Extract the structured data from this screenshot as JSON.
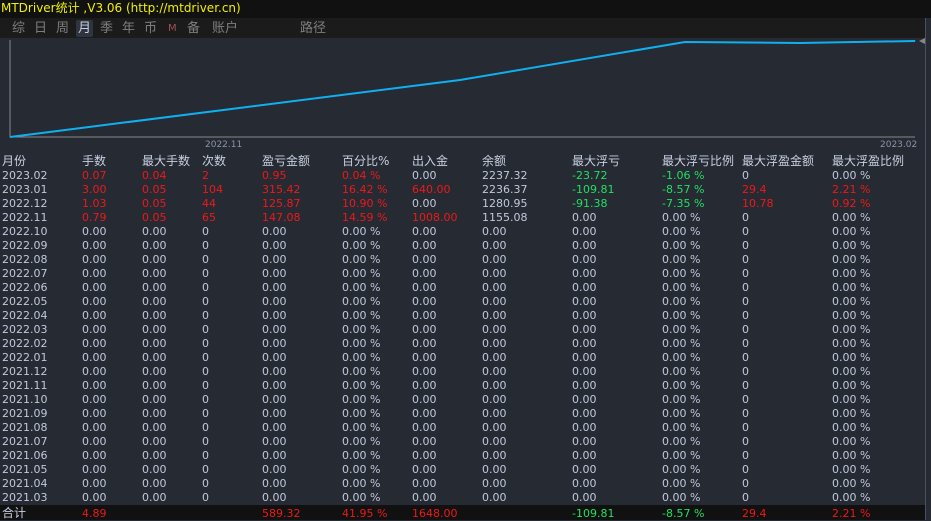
{
  "title": "MTDriver统计 ,V3.06 (http://mtdriver.cn)",
  "tabs": [
    {
      "label": "综",
      "active": false
    },
    {
      "label": "日",
      "active": false
    },
    {
      "label": "周",
      "active": false
    },
    {
      "label": "月",
      "active": true
    },
    {
      "label": "季",
      "active": false
    },
    {
      "label": "年",
      "active": false
    },
    {
      "label": "币",
      "active": false
    },
    {
      "label": "M",
      "active": false
    },
    {
      "label": "备",
      "active": false
    },
    {
      "label": "账户",
      "active": false
    },
    {
      "label": "路径",
      "active": false
    }
  ],
  "chart_data": {
    "type": "line",
    "x_labels": [
      "2022.11",
      "2023.02"
    ],
    "series": [
      {
        "name": "余额",
        "color": "#10b0f0",
        "values": [
          0,
          1155.08,
          1280.95,
          2236.37,
          2237.32
        ]
      }
    ]
  },
  "columns": [
    "月份",
    "手数",
    "最大手数",
    "次数",
    "盈亏金额",
    "百分比%",
    "出入金",
    "余额",
    "最大浮亏",
    "最大浮亏比例",
    "最大浮盈金额",
    "最大浮盈比例"
  ],
  "rows": [
    [
      "2023.02",
      "0.07",
      "0.04",
      "2",
      "0.95",
      "0.04 %",
      "0.00",
      "2237.32",
      "-23.72",
      "-1.06 %",
      "0",
      "0.00 %"
    ],
    [
      "2023.01",
      "3.00",
      "0.05",
      "104",
      "315.42",
      "16.42 %",
      "640.00",
      "2236.37",
      "-109.81",
      "-8.57 %",
      "29.4",
      "2.21 %"
    ],
    [
      "2022.12",
      "1.03",
      "0.05",
      "44",
      "125.87",
      "10.90 %",
      "0.00",
      "1280.95",
      "-91.38",
      "-7.35 %",
      "10.78",
      "0.92 %"
    ],
    [
      "2022.11",
      "0.79",
      "0.05",
      "65",
      "147.08",
      "14.59 %",
      "1008.00",
      "1155.08",
      "0.00",
      "0.00 %",
      "0",
      "0.00 %"
    ],
    [
      "2022.10"
    ],
    [
      "2022.09"
    ],
    [
      "2022.08"
    ],
    [
      "2022.07"
    ],
    [
      "2022.06"
    ],
    [
      "2022.05"
    ],
    [
      "2022.04"
    ],
    [
      "2022.03"
    ],
    [
      "2022.02"
    ],
    [
      "2022.01"
    ],
    [
      "2021.12"
    ],
    [
      "2021.11"
    ],
    [
      "2021.10"
    ],
    [
      "2021.09"
    ],
    [
      "2021.08"
    ],
    [
      "2021.07"
    ],
    [
      "2021.06"
    ],
    [
      "2021.05"
    ],
    [
      "2021.04"
    ],
    [
      "2021.03"
    ]
  ],
  "zero_row": [
    "0.00",
    "0.00",
    "0",
    "0.00",
    "0.00 %",
    "0.00",
    "0.00",
    "0.00",
    "0.00 %",
    "0",
    "0.00 %"
  ],
  "total": {
    "label": "合计",
    "lots": "4.89",
    "profit": "589.32",
    "percent": "41.95 %",
    "deposit": "1648.00",
    "max_float_loss": "-109.81",
    "max_float_loss_pct": "-8.57 %",
    "max_float_profit": "29.4",
    "max_float_profit_pct": "2.21 %"
  }
}
